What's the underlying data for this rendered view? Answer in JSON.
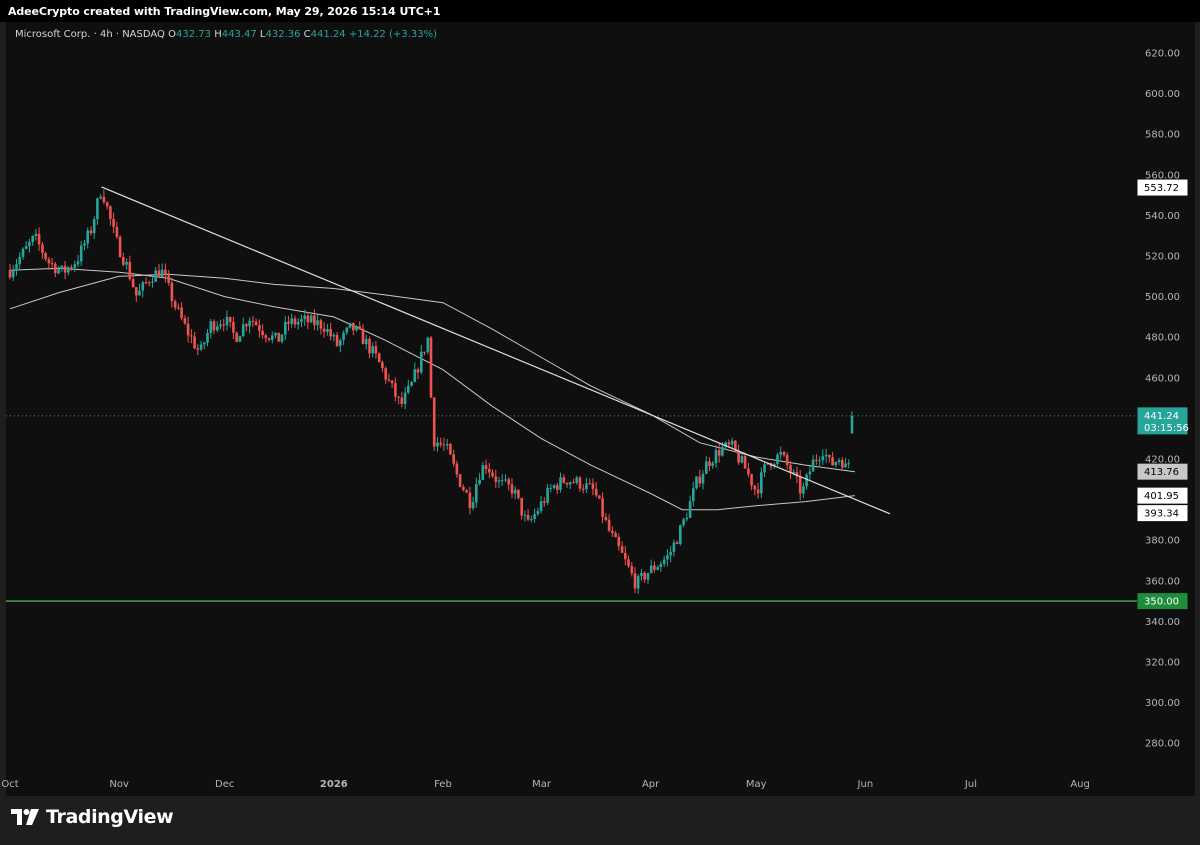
{
  "header": {
    "attribution": "AdeeCrypto created with TradingView.com, May 29, 2026 15:14 UTC+1"
  },
  "legend": {
    "symbol": "Microsoft Corp. · 4h · NASDAQ",
    "o_label": "O",
    "o_value": "432.73",
    "h_label": "H",
    "h_value": "443.47",
    "l_label": "L",
    "l_value": "432.36",
    "c_label": "C",
    "c_value": "441.24",
    "change": "+14.22 (+3.33%)"
  },
  "colors": {
    "up": "#26a69a",
    "down": "#ef5350",
    "support_line": "#4caf50",
    "moving_average": "#c8c8c8",
    "trendline": "#e0e0e0",
    "background": "#0f0f0f"
  },
  "brand": {
    "name": "TradingView",
    "logo_icon": "tradingview-logo-icon"
  },
  "chart_data": {
    "type": "candlestick",
    "ylim": [
      268,
      630
    ],
    "yticks": [
      "620.00",
      "600.00",
      "580.00",
      "560.00",
      "540.00",
      "520.00",
      "500.00",
      "480.00",
      "460.00",
      "440.00",
      "420.00",
      "400.00",
      "380.00",
      "360.00",
      "340.00",
      "320.00",
      "300.00",
      "280.00"
    ],
    "xticks": [
      "Oct",
      "Nov",
      "Dec",
      "2026",
      "Feb",
      "Mar",
      "Apr",
      "May",
      "Jun",
      "Jul",
      "Aug"
    ],
    "price_path": [
      [
        "2025-10-01",
        513
      ],
      [
        "2025-10-05",
        522
      ],
      [
        "2025-10-08",
        529
      ],
      [
        "2025-10-12",
        517
      ],
      [
        "2025-10-16",
        512
      ],
      [
        "2025-10-20",
        518
      ],
      [
        "2025-10-24",
        533
      ],
      [
        "2025-10-27",
        553.72
      ],
      [
        "2025-10-29",
        541
      ],
      [
        "2025-10-31",
        528
      ],
      [
        "2025-11-03",
        516
      ],
      [
        "2025-11-06",
        500
      ],
      [
        "2025-11-10",
        510
      ],
      [
        "2025-11-13",
        513
      ],
      [
        "2025-11-17",
        495
      ],
      [
        "2025-11-20",
        484
      ],
      [
        "2025-11-24",
        472
      ],
      [
        "2025-11-27",
        486
      ],
      [
        "2025-12-01",
        489
      ],
      [
        "2025-12-04",
        480
      ],
      [
        "2025-12-08",
        490
      ],
      [
        "2025-12-12",
        483
      ],
      [
        "2025-12-16",
        478
      ],
      [
        "2025-12-19",
        487
      ],
      [
        "2025-12-24",
        488
      ],
      [
        "2025-12-29",
        486
      ],
      [
        "2026-01-02",
        476
      ],
      [
        "2026-01-06",
        485
      ],
      [
        "2026-01-09",
        480
      ],
      [
        "2026-01-13",
        470
      ],
      [
        "2026-01-16",
        460
      ],
      [
        "2026-01-20",
        446
      ],
      [
        "2026-01-23",
        456
      ],
      [
        "2026-01-26",
        471
      ],
      [
        "2026-01-28",
        481
      ],
      [
        "2026-01-29",
        430
      ],
      [
        "2026-02-02",
        425
      ],
      [
        "2026-02-05",
        412
      ],
      [
        "2026-02-09",
        398
      ],
      [
        "2026-02-11",
        412
      ],
      [
        "2026-02-13",
        418
      ],
      [
        "2026-02-17",
        408
      ],
      [
        "2026-02-21",
        405
      ],
      [
        "2026-02-25",
        387
      ],
      [
        "2026-03-01",
        398
      ],
      [
        "2026-03-04",
        406
      ],
      [
        "2026-03-08",
        410
      ],
      [
        "2026-03-12",
        408
      ],
      [
        "2026-03-16",
        404
      ],
      [
        "2026-03-20",
        385
      ],
      [
        "2026-03-24",
        372
      ],
      [
        "2026-03-28",
        358
      ],
      [
        "2026-03-31",
        364
      ],
      [
        "2026-04-03",
        368
      ],
      [
        "2026-04-06",
        372
      ],
      [
        "2026-04-09",
        383
      ],
      [
        "2026-04-11",
        392
      ],
      [
        "2026-04-14",
        408
      ],
      [
        "2026-04-17",
        418
      ],
      [
        "2026-04-21",
        425
      ],
      [
        "2026-04-24",
        426
      ],
      [
        "2026-04-28",
        415
      ],
      [
        "2026-05-01",
        404
      ],
      [
        "2026-05-04",
        418
      ],
      [
        "2026-05-08",
        422
      ],
      [
        "2026-05-12",
        410
      ],
      [
        "2026-05-14",
        403
      ],
      [
        "2026-05-17",
        418
      ],
      [
        "2026-05-20",
        425
      ],
      [
        "2026-05-22",
        417
      ],
      [
        "2026-05-25",
        421
      ],
      [
        "2026-05-27",
        413
      ],
      [
        "2026-05-28",
        432
      ],
      [
        "2026-05-29",
        441.24
      ]
    ],
    "moving_average_fast": [
      [
        "2025-10-01",
        513
      ],
      [
        "2025-10-15",
        514
      ],
      [
        "2025-11-01",
        512
      ],
      [
        "2025-11-15",
        509
      ],
      [
        "2025-12-01",
        500
      ],
      [
        "2025-12-15",
        495
      ],
      [
        "2026-01-01",
        490
      ],
      [
        "2026-01-15",
        479
      ],
      [
        "2026-02-01",
        464
      ],
      [
        "2026-02-15",
        446
      ],
      [
        "2026-03-01",
        430
      ],
      [
        "2026-03-15",
        417
      ],
      [
        "2026-04-01",
        403
      ],
      [
        "2026-04-10",
        395
      ],
      [
        "2026-04-20",
        395
      ],
      [
        "2026-05-01",
        397
      ],
      [
        "2026-05-15",
        399
      ],
      [
        "2026-05-29",
        401.95
      ]
    ],
    "moving_average_slow": [
      [
        "2025-10-01",
        494
      ],
      [
        "2025-10-15",
        502
      ],
      [
        "2025-11-01",
        510
      ],
      [
        "2025-11-15",
        511
      ],
      [
        "2025-12-01",
        509
      ],
      [
        "2025-12-15",
        506
      ],
      [
        "2026-01-01",
        504
      ],
      [
        "2026-01-15",
        501
      ],
      [
        "2026-02-01",
        497
      ],
      [
        "2026-02-15",
        484
      ],
      [
        "2026-03-01",
        470
      ],
      [
        "2026-03-15",
        456
      ],
      [
        "2026-04-01",
        442
      ],
      [
        "2026-04-15",
        428
      ],
      [
        "2026-05-01",
        421
      ],
      [
        "2026-05-15",
        417
      ],
      [
        "2026-05-29",
        413.76
      ]
    ],
    "trendline": {
      "from": [
        "2025-10-27",
        554
      ],
      "to": [
        "2026-06-08",
        393
      ]
    },
    "support_level": 350,
    "price_tags": [
      {
        "label": "553.72",
        "value": 553.72,
        "style": "white"
      },
      {
        "label": "441.24",
        "sub": "03:15:56",
        "value": 441.24,
        "style": "green"
      },
      {
        "label": "413.76",
        "value": 413.76,
        "style": "gray"
      },
      {
        "label": "401.95",
        "value": 401.95,
        "style": "white"
      },
      {
        "label": "393.34",
        "value": 393.34,
        "style": "white"
      },
      {
        "label": "350.00",
        "value": 350.0,
        "style": "green"
      }
    ],
    "last_price": 441.24,
    "grid": false
  }
}
